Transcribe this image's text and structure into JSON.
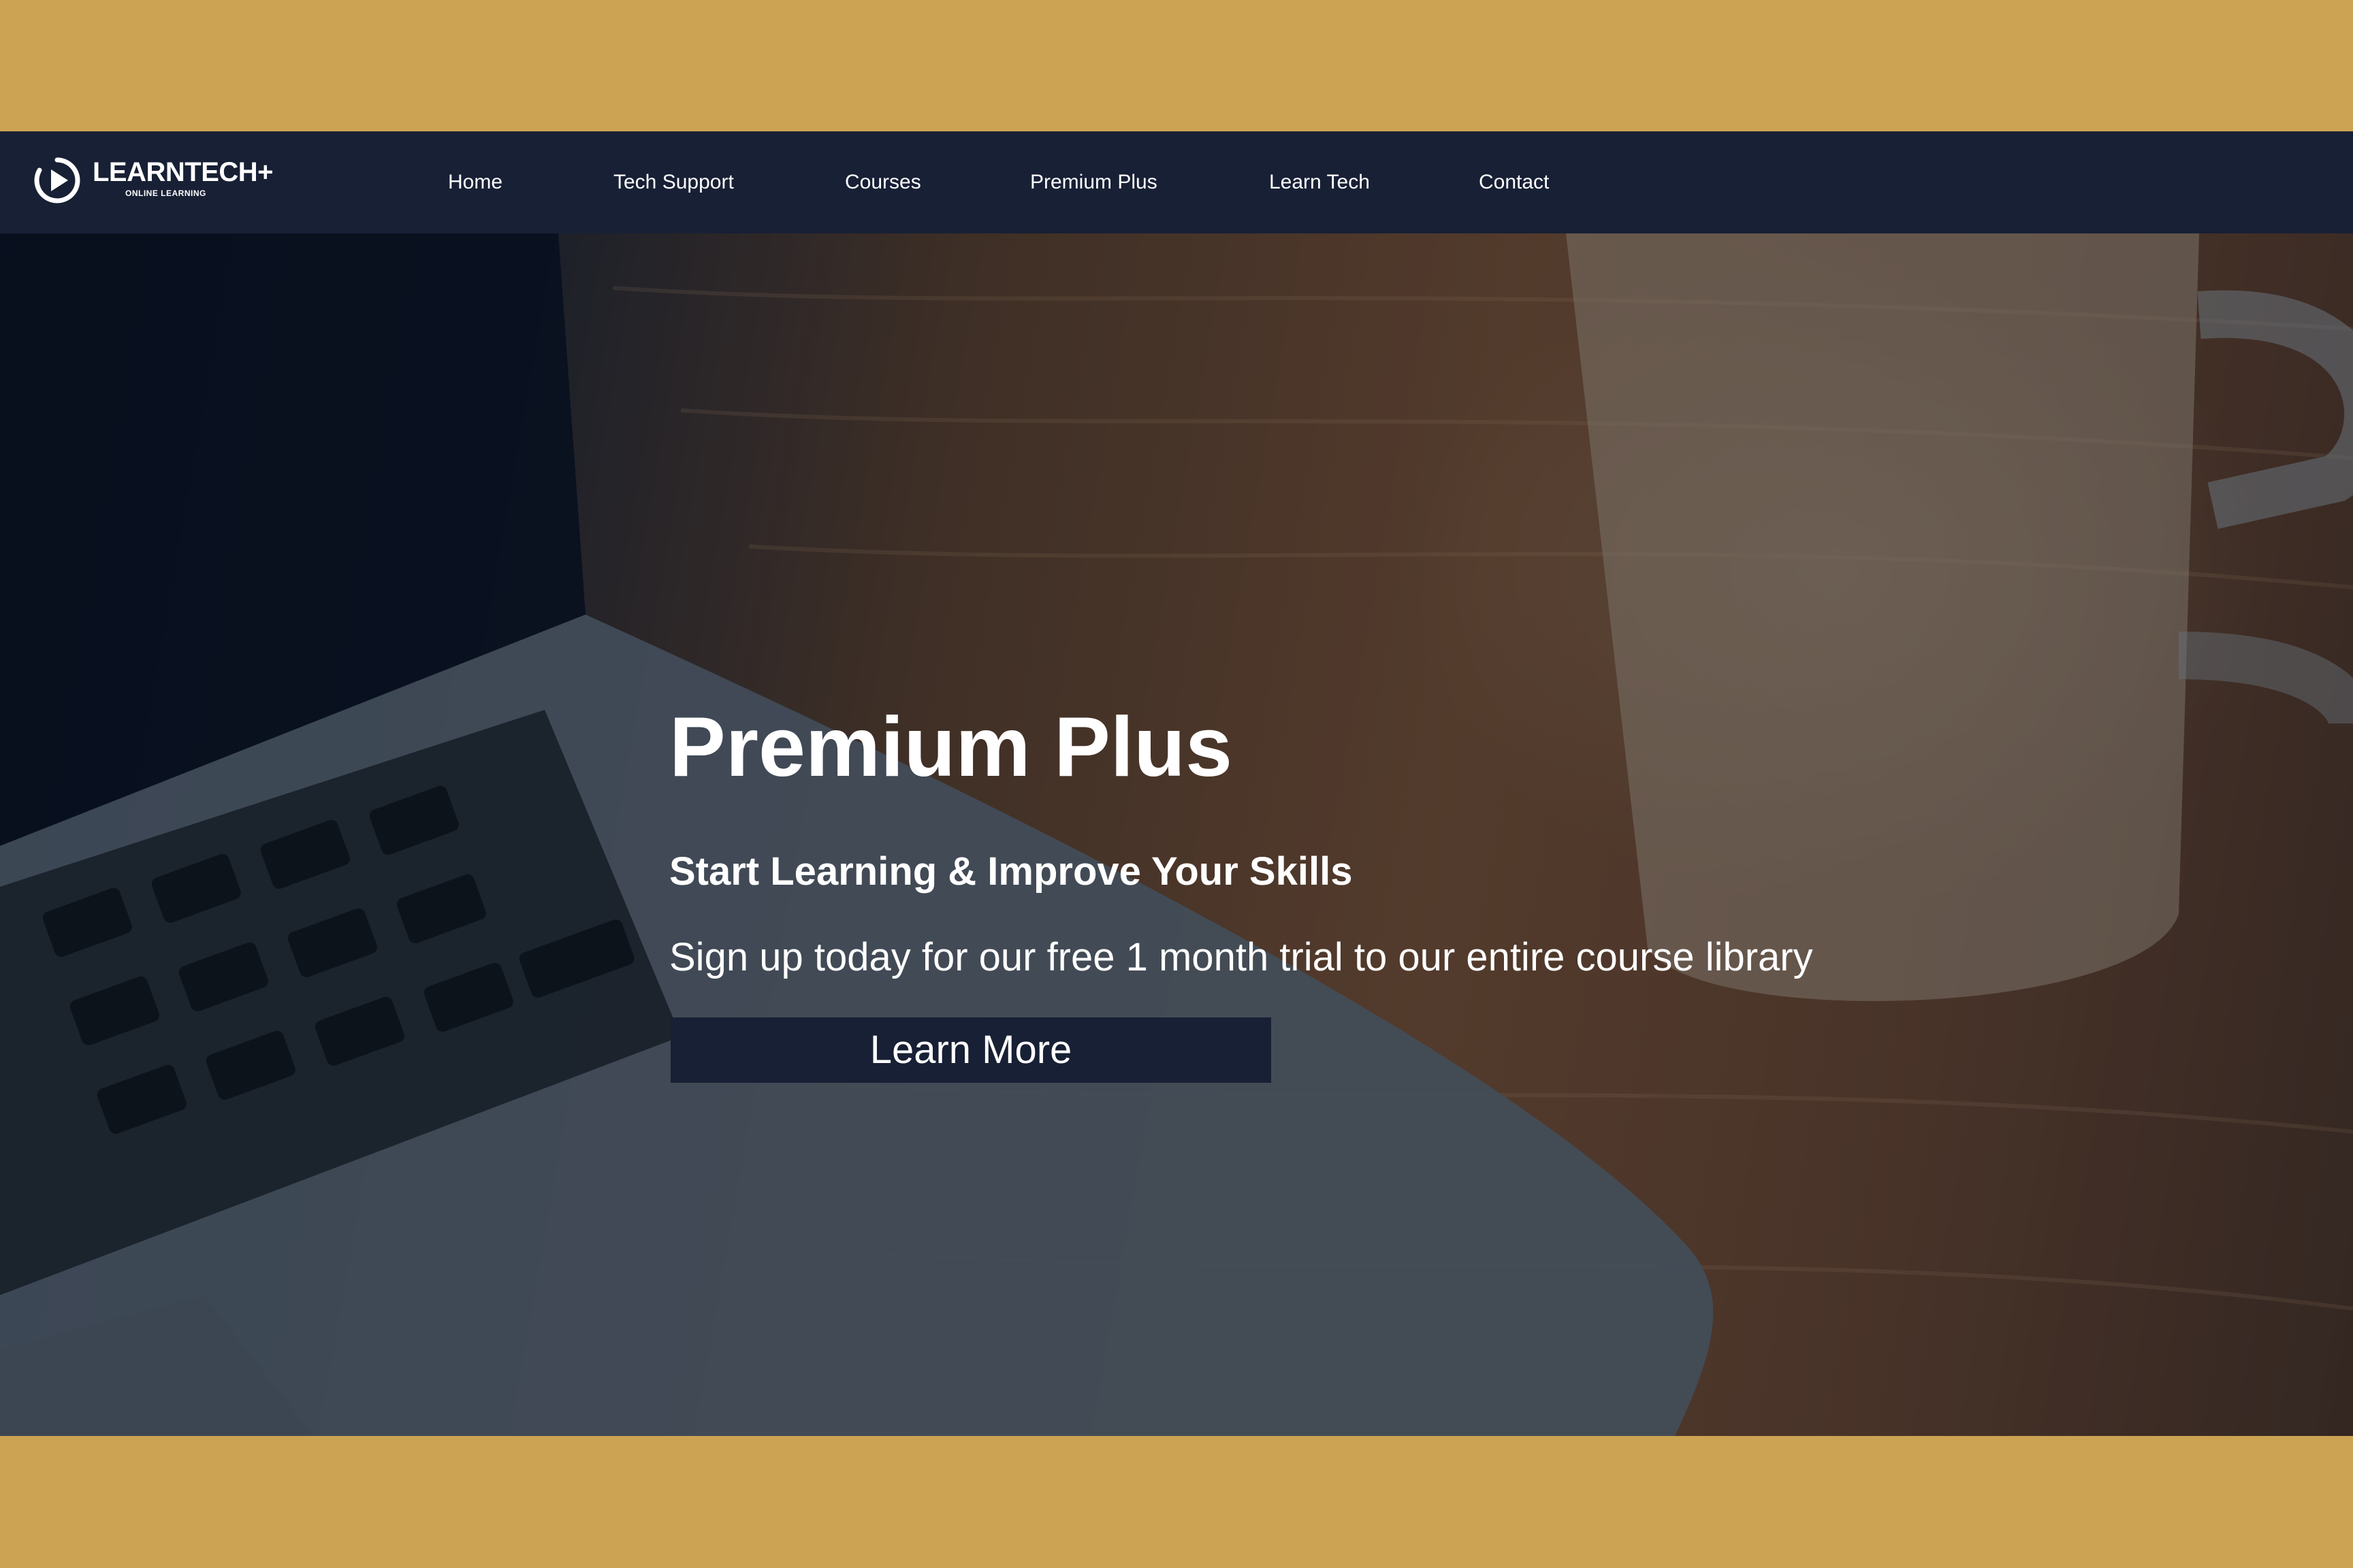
{
  "brand": {
    "name": "LEARNTECH+",
    "tagline": "ONLINE LEARNING",
    "icon": "play-circle-icon"
  },
  "nav": {
    "items": [
      {
        "label": "Home"
      },
      {
        "label": "Tech Support"
      },
      {
        "label": "Courses"
      },
      {
        "label": "Premium Plus"
      },
      {
        "label": "Learn Tech"
      },
      {
        "label": "Contact"
      }
    ]
  },
  "hero": {
    "title": "Premium Plus",
    "subtitle": "Start Learning & Improve Your Skills",
    "description": "Sign up today for our free 1 month trial to our entire course library",
    "button_label": "Learn More"
  },
  "colors": {
    "frame": "#CBA352",
    "navbar": "#182035",
    "button": "#182035",
    "text": "#FFFFFF"
  }
}
